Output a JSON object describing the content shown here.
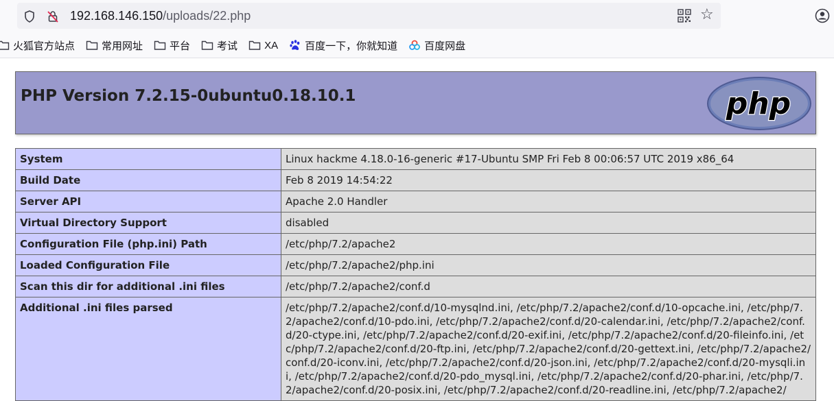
{
  "browser": {
    "url_host": "192.168.146.150",
    "url_path": "/uploads/22.php",
    "bookmarks": [
      {
        "label": "火狐官方站点",
        "icon": "folder-icon"
      },
      {
        "label": "常用网址",
        "icon": "folder-icon"
      },
      {
        "label": "平台",
        "icon": "folder-icon"
      },
      {
        "label": "考试",
        "icon": "folder-icon"
      },
      {
        "label": "XA",
        "icon": "folder-icon"
      },
      {
        "label": "百度一下，你就知道",
        "icon": "baidu-paw-icon"
      },
      {
        "label": "百度网盘",
        "icon": "baidu-netdisk-icon"
      }
    ]
  },
  "page": {
    "title": "PHP Version 7.2.15-0ubuntu0.18.10.1",
    "logo_text": "php",
    "rows": [
      {
        "key": "System",
        "value": "Linux hackme 4.18.0-16-generic #17-Ubuntu SMP Fri Feb 8 00:06:57 UTC 2019 x86_64"
      },
      {
        "key": "Build Date",
        "value": "Feb 8 2019 14:54:22"
      },
      {
        "key": "Server API",
        "value": "Apache 2.0 Handler"
      },
      {
        "key": "Virtual Directory Support",
        "value": "disabled"
      },
      {
        "key": "Configuration File (php.ini) Path",
        "value": "/etc/php/7.2/apache2"
      },
      {
        "key": "Loaded Configuration File",
        "value": "/etc/php/7.2/apache2/php.ini"
      },
      {
        "key": "Scan this dir for additional .ini files",
        "value": "/etc/php/7.2/apache2/conf.d"
      },
      {
        "key": "Additional .ini files parsed",
        "value": "/etc/php/7.2/apache2/conf.d/10-mysqlnd.ini, /etc/php/7.2/apache2/conf.d/10-opcache.ini, /etc/php/7.2/apache2/conf.d/10-pdo.ini, /etc/php/7.2/apache2/conf.d/20-calendar.ini, /etc/php/7.2/apache2/conf.d/20-ctype.ini, /etc/php/7.2/apache2/conf.d/20-exif.ini, /etc/php/7.2/apache2/conf.d/20-fileinfo.ini, /etc/php/7.2/apache2/conf.d/20-ftp.ini, /etc/php/7.2/apache2/conf.d/20-gettext.ini, /etc/php/7.2/apache2/conf.d/20-iconv.ini, /etc/php/7.2/apache2/conf.d/20-json.ini, /etc/php/7.2/apache2/conf.d/20-mysqli.ini, /etc/php/7.2/apache2/conf.d/20-pdo_mysql.ini, /etc/php/7.2/apache2/conf.d/20-phar.ini, /etc/php/7.2/apache2/conf.d/20-posix.ini, /etc/php/7.2/apache2/conf.d/20-readline.ini, /etc/php/7.2/apache2/"
      }
    ]
  }
}
